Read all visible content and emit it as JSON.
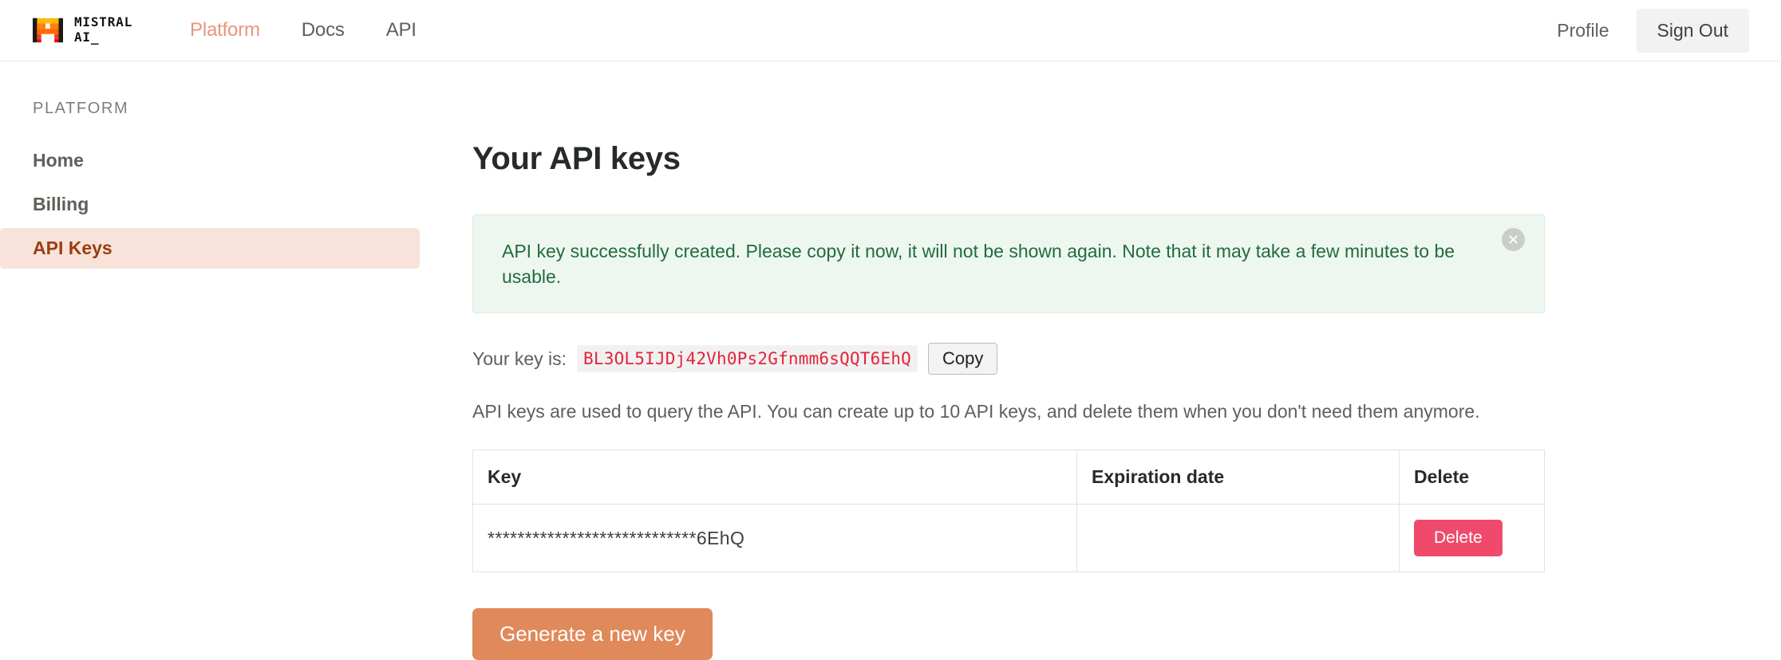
{
  "header": {
    "logo_icon": "mistral-logo-icon",
    "brand_name": "MISTRAL\nAI_",
    "nav": [
      {
        "label": "Platform",
        "active": true
      },
      {
        "label": "Docs",
        "active": false
      },
      {
        "label": "API",
        "active": false
      }
    ],
    "profile_label": "Profile",
    "signout_label": "Sign Out"
  },
  "sidebar": {
    "section_label": "PLATFORM",
    "items": [
      {
        "label": "Home",
        "active": false
      },
      {
        "label": "Billing",
        "active": false
      },
      {
        "label": "API Keys",
        "active": true
      }
    ]
  },
  "main": {
    "title": "Your API keys",
    "alert": {
      "message": "API key successfully created. Please copy it now, it will not be shown again. Note that it may take a few minutes to be usable.",
      "close_icon": "close-icon"
    },
    "key_line": {
      "label": "Your key is:",
      "value": "BL3OL5IJDj42Vh0Ps2Gfnmm6sQQT6EhQ",
      "copy_label": "Copy"
    },
    "description": "API keys are used to query the API. You can create up to 10 API keys, and delete them when you don't need them anymore.",
    "table": {
      "columns": [
        "Key",
        "Expiration date",
        "Delete"
      ],
      "rows": [
        {
          "key": "****************************6EhQ",
          "expiration_date": "",
          "delete_label": "Delete"
        }
      ]
    },
    "generate_label": "Generate a new key"
  },
  "colors": {
    "accent_orange": "#e0895a",
    "brand_peach": "#e8957c",
    "active_nav_bg": "#f7e3da",
    "active_nav_text": "#9b3d12",
    "alert_bg": "#edf7f0",
    "alert_text": "#226b3f",
    "key_text": "#e2243c",
    "delete_red": "#ef4a6b"
  }
}
